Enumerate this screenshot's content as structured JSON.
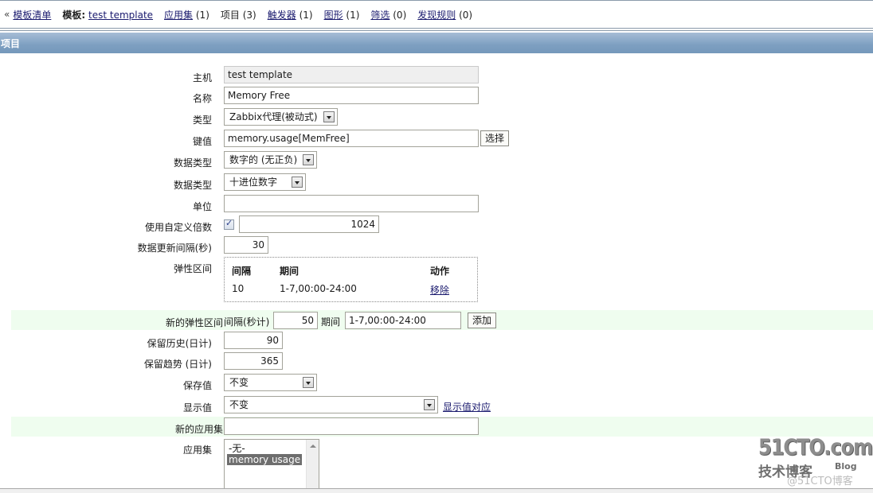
{
  "nav": {
    "back_glyph": "«",
    "template_list": "模板清单",
    "template_label": "模板:",
    "template_name": "test template",
    "items": [
      {
        "label": "应用集",
        "count": "(1)",
        "link": true
      },
      {
        "label": "项目",
        "count": "(3)",
        "link": false
      },
      {
        "label": "触发器",
        "count": "(1)",
        "link": true
      },
      {
        "label": "图形",
        "count": "(1)",
        "link": true
      },
      {
        "label": "筛选",
        "count": "(0)",
        "link": true
      },
      {
        "label": "发现规则",
        "count": "(0)",
        "link": true
      }
    ]
  },
  "section": {
    "title": "项目"
  },
  "form": {
    "host": {
      "label": "主机",
      "value": "test template"
    },
    "name": {
      "label": "名称",
      "value": "Memory Free"
    },
    "type": {
      "label": "类型",
      "value": "Zabbix代理(被动式)"
    },
    "key": {
      "label": "键值",
      "value": "memory.usage[MemFree]",
      "button": "选择"
    },
    "value_type": {
      "label": "数据类型",
      "value": "数字的 (无正负)"
    },
    "data_type": {
      "label": "数据类型",
      "value": "十进位数字"
    },
    "units": {
      "label": "单位",
      "value": ""
    },
    "multiplier": {
      "label": "使用自定义倍数",
      "checked": true,
      "value": "1024"
    },
    "delay": {
      "label": "数据更新间隔(秒)",
      "value": "30"
    },
    "flex": {
      "label": "弹性区间",
      "headers": {
        "interval": "间隔",
        "period": "期间",
        "action": "动作"
      },
      "rows": [
        {
          "interval": "10",
          "period": "1-7,00:00-24:00",
          "action": "移除"
        }
      ]
    },
    "new_flex": {
      "label": "新的弹性区间",
      "interval_label": "间隔(秒计)",
      "interval_value": "50",
      "period_label": "期间",
      "period_value": "1-7,00:00-24:00",
      "add_button": "添加"
    },
    "history": {
      "label": "保留历史(日计)",
      "value": "90"
    },
    "trends": {
      "label": "保留趋势 (日计)",
      "value": "365"
    },
    "store_value": {
      "label": "保存值",
      "value": "不变"
    },
    "show_value": {
      "label": "显示值",
      "value": "不变",
      "link": "显示值对应"
    },
    "new_application": {
      "label": "新的应用集",
      "value": ""
    },
    "applications": {
      "label": "应用集",
      "options": [
        {
          "label": "-无-",
          "selected": false
        },
        {
          "label": "memory usage",
          "selected": true
        }
      ]
    }
  },
  "watermark": {
    "main": "51CTO.com",
    "sub": "技术博客",
    "blog": "Blog",
    "at": "@51CTO博客"
  },
  "colors": {
    "header_blue": "#7d9fc1",
    "green_row": "#effdef",
    "link": "#1a1a6e",
    "selected_option": "#6e6e6e"
  }
}
